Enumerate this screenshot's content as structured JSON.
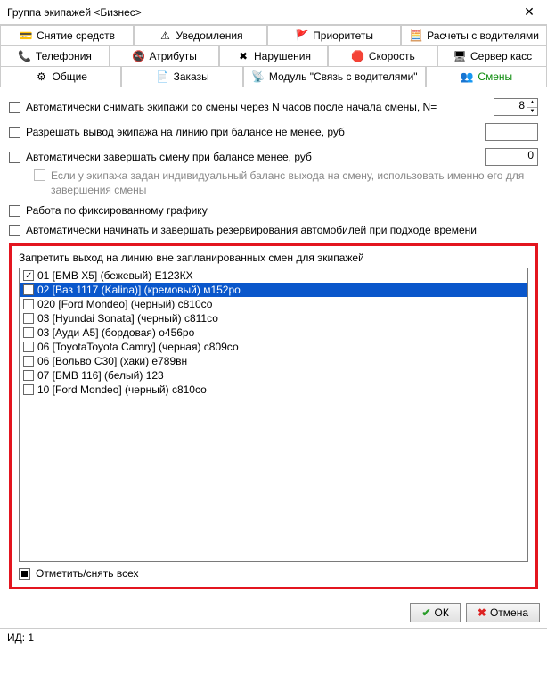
{
  "window": {
    "title": "Группа экипажей <Бизнес>"
  },
  "tabs": {
    "row1": [
      {
        "icon": "💳",
        "label": "Снятие средств"
      },
      {
        "icon": "⚠",
        "label": "Уведомления"
      },
      {
        "icon": "🚩",
        "label": "Приоритеты"
      },
      {
        "icon": "🧮",
        "label": "Расчеты с водителями"
      }
    ],
    "row2": [
      {
        "icon": "📞",
        "label": "Телефония"
      },
      {
        "icon": "🚭",
        "label": "Атрибуты"
      },
      {
        "icon": "✖",
        "label": "Нарушения"
      },
      {
        "icon": "🛑",
        "label": "Скорость"
      },
      {
        "icon": "🖥",
        "label": "Сервер касс"
      }
    ],
    "row3": [
      {
        "icon": "⚙",
        "label": "Общие"
      },
      {
        "icon": "📄",
        "label": "Заказы"
      },
      {
        "icon": "📡",
        "label": "Модуль \"Связь с водителями\""
      },
      {
        "icon": "👥",
        "label": "Смены",
        "active": true
      }
    ]
  },
  "options": {
    "auto_remove_label": "Автоматически снимать экипажи со смены через N часов после начала смены, N=",
    "auto_remove_value": "8",
    "allow_line_label": "Разрешать вывод экипажа на линию при балансе не менее, руб",
    "allow_line_value": "",
    "auto_close_label": "Автоматически завершать смену при балансе менее, руб",
    "auto_close_value": "0",
    "individual_balance_label": "Если у экипажа задан индивидуальный баланс выхода на смену, использовать именно его для завершения смены",
    "fixed_schedule_label": "Работа по фиксированному графику",
    "auto_reserve_label": "Автоматически начинать и завершать резервирования автомобилей при подходе времени"
  },
  "group": {
    "title": "Запретить выход на линию вне запланированных смен для экипажей",
    "items": [
      {
        "checked": true,
        "label": "01 [БМВ X5] (бежевый) Е123КХ"
      },
      {
        "checked": true,
        "selected": true,
        "label": "02 [Ваз 1117 (Kalina)] (кремовый) м152ро"
      },
      {
        "checked": false,
        "label": "020 [Ford Mondeo] (черный) с810со"
      },
      {
        "checked": false,
        "label": "03 [Hyundai Sonata] (черный) с811со"
      },
      {
        "checked": false,
        "label": "03 [Ауди А5] (бордовая) о456ро"
      },
      {
        "checked": false,
        "label": "06 [ToyotaToyota Camry] (черная) с809со"
      },
      {
        "checked": false,
        "label": "06 [Вольво С30] (хаки) е789вн"
      },
      {
        "checked": false,
        "label": "07 [БМВ 116] (белый) 123"
      },
      {
        "checked": false,
        "label": "10 [Ford Mondeo] (черный) с810со"
      }
    ],
    "toggle_all_label": "Отметить/снять всех"
  },
  "footer": {
    "ok_label": "ОК",
    "cancel_label": "Отмена"
  },
  "status": {
    "text": "ИД: 1"
  }
}
